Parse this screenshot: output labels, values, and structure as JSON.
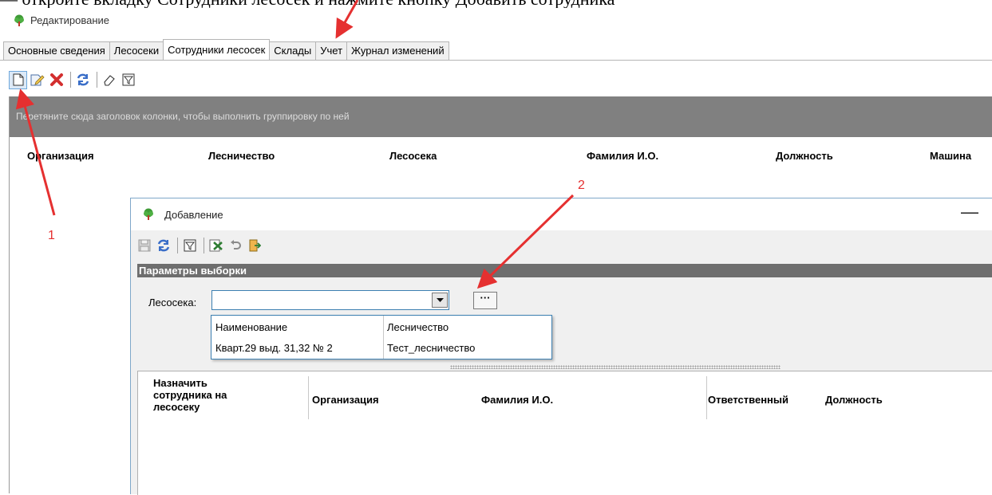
{
  "document": {
    "caption_fragment": "— откройте вкладку Сотрудники лесосек и нажмите кнопку Добавить сотрудника"
  },
  "window": {
    "title": "Редактирование"
  },
  "tabs": [
    {
      "label": "Основные сведения",
      "active": false
    },
    {
      "label": "Лесосеки",
      "active": false
    },
    {
      "label": "Сотрудники лесосек",
      "active": true
    },
    {
      "label": "Склады",
      "active": false
    },
    {
      "label": "Учет",
      "active": false
    },
    {
      "label": "Журнал изменений",
      "active": false
    }
  ],
  "toolbar": {
    "buttons": [
      "new-document-icon",
      "edit-icon",
      "delete-icon",
      "refresh-icon",
      "eraser-icon",
      "filter-icon"
    ]
  },
  "main_grid": {
    "group_hint": "Перетяните сюда заголовок колонки, чтобы выполнить группировку по ней",
    "columns": [
      "Организация",
      "Лесничество",
      "Лесосека",
      "Фамилия И.О.",
      "Должность",
      "Машина"
    ]
  },
  "dialog": {
    "title": "Добавление",
    "minimize": "—",
    "toolbar": [
      "save-icon",
      "refresh-icon",
      "filter-icon",
      "excel-icon",
      "undo-icon",
      "exit-icon"
    ],
    "params_header": "Параметры выборки",
    "field_label": "Лесосека:",
    "field_value": "",
    "ellipsis": "···",
    "dropdown": {
      "columns": [
        "Наименование",
        "Лесничество"
      ],
      "rows": [
        [
          "Кварт.29 выд. 31,32 № 2",
          "Тест_лесничество"
        ]
      ]
    },
    "lower_grid": {
      "columns": [
        "Назначить сотрудника на лесосеку",
        "Организация",
        "Фамилия И.О.",
        "Ответственный",
        "Должность"
      ]
    }
  },
  "annotations": {
    "arrow_color": "#e53030",
    "labels": [
      "1",
      "2"
    ]
  },
  "colors": {
    "group_panel": "#808080",
    "params_header": "#6e6e6e",
    "focus_border": "#3c7fb1",
    "tree_green": "#3f9b37",
    "tree_trunk": "#c0392b"
  }
}
